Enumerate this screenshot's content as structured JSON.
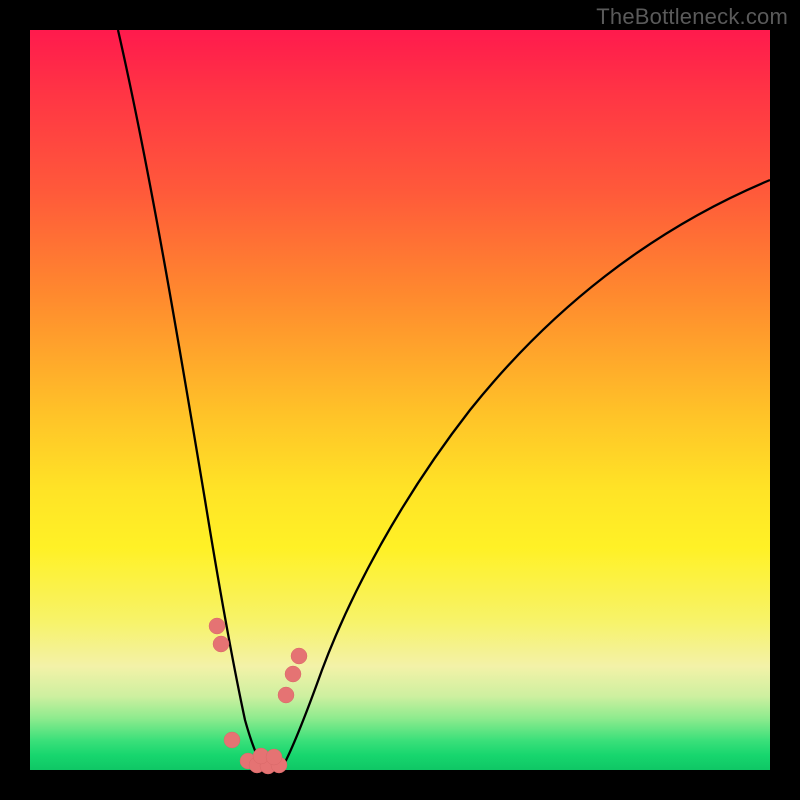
{
  "watermark": "TheBottleneck.com",
  "chart_data": {
    "type": "line",
    "title": "",
    "xlabel": "",
    "ylabel": "",
    "xlim": [
      0,
      100
    ],
    "ylim": [
      0,
      100
    ],
    "grid": false,
    "legend": false,
    "gradient_meaning_top_to_bottom": "red = high bottleneck, green = no bottleneck",
    "series": [
      {
        "name": "left-curve",
        "x": [
          12,
          15,
          18,
          21,
          23,
          24.5,
          26,
          27.5,
          29,
          31
        ],
        "y": [
          100,
          82,
          63,
          44,
          30,
          22,
          15,
          9,
          4,
          0
        ]
      },
      {
        "name": "right-curve",
        "x": [
          34,
          36,
          38,
          41,
          45,
          52,
          60,
          70,
          82,
          100
        ],
        "y": [
          0,
          3,
          7,
          13,
          21,
          33,
          45,
          56,
          67,
          80
        ]
      },
      {
        "name": "threshold-markers-left",
        "type": "scatter",
        "x": [
          25.2,
          25.8,
          27.3,
          29.5
        ],
        "y": [
          19.5,
          16.5,
          4.0,
          1.5
        ]
      },
      {
        "name": "threshold-markers-right",
        "type": "scatter",
        "x": [
          31.0,
          32.5,
          34.5,
          35.6,
          36.4
        ],
        "y": [
          1.5,
          1.8,
          10.0,
          13.0,
          15.5
        ]
      },
      {
        "name": "valley-floor",
        "type": "scatter",
        "x": [
          29.0,
          30.5,
          32.0,
          33.5
        ],
        "y": [
          0.8,
          0.8,
          0.8,
          0.8
        ]
      }
    ],
    "marker_color": "#e57373",
    "curve_color": "#000000"
  }
}
